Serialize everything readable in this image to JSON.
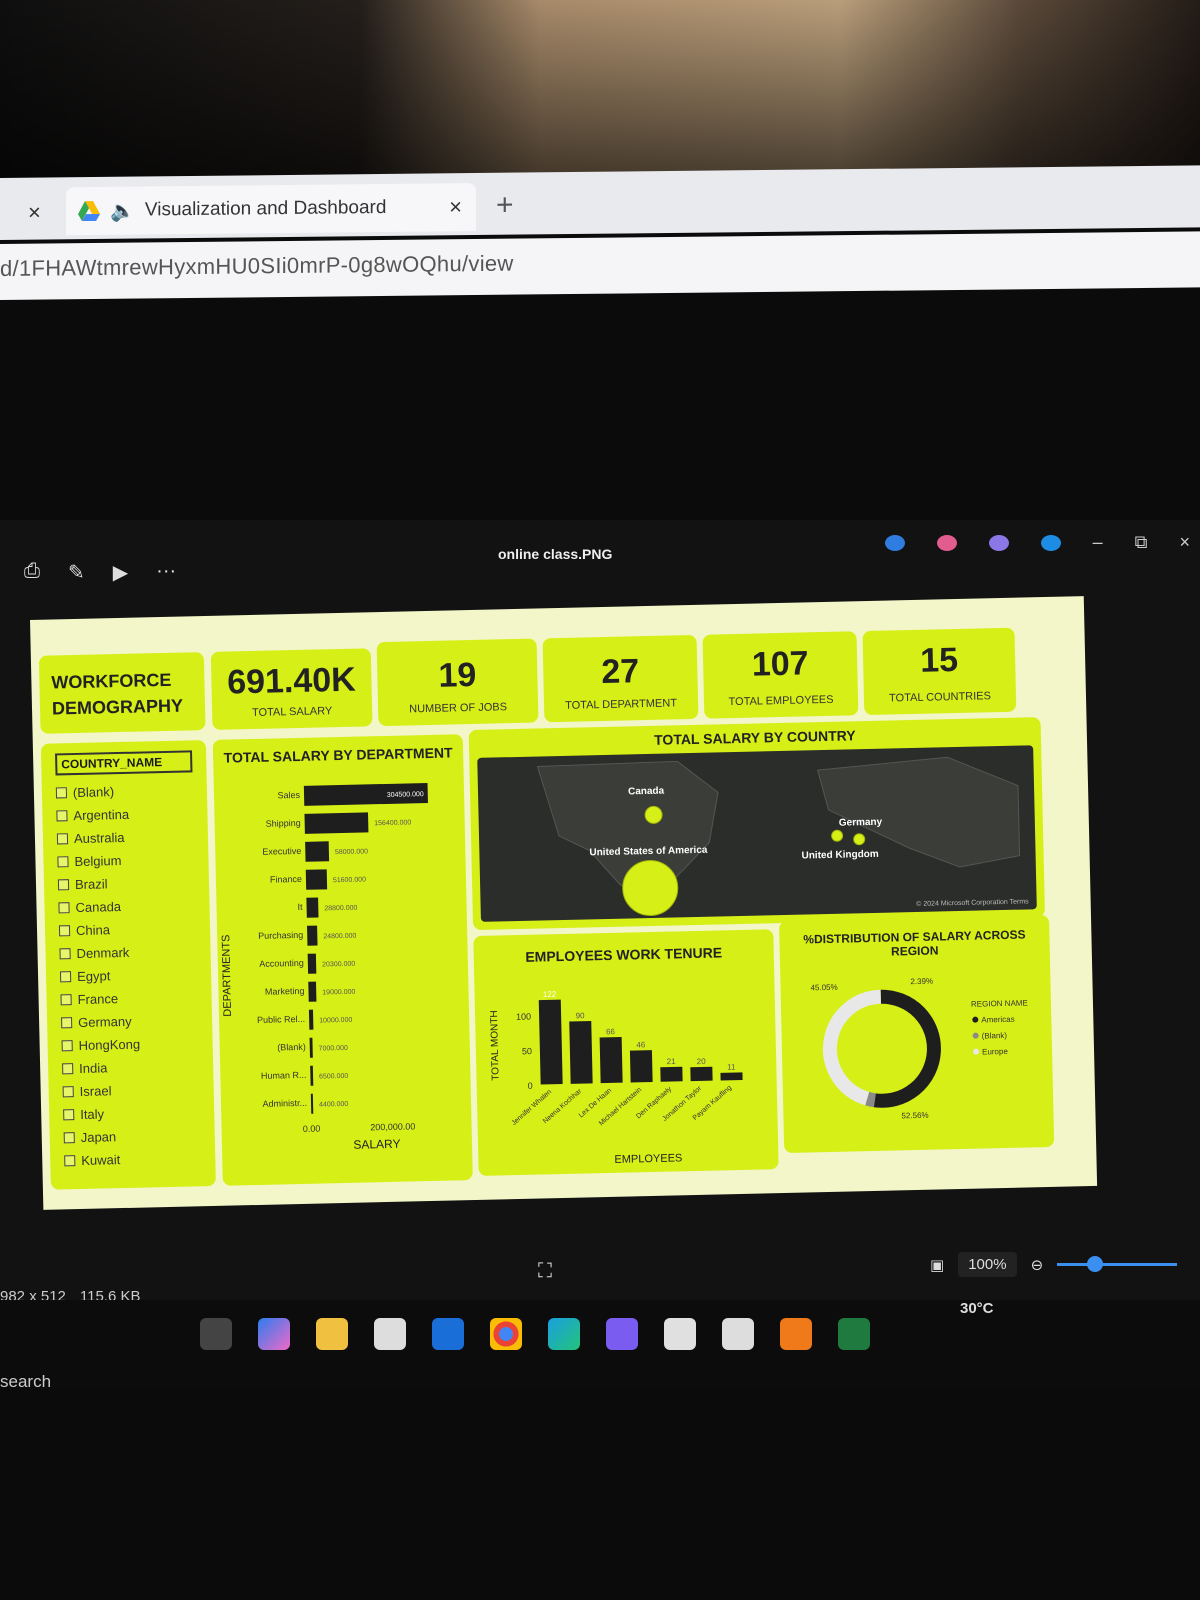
{
  "browser": {
    "tab_title": "Visualization and Dashboard",
    "url": "d/1FHAWtmrewHyxmHU0SIi0mrP-0g8wOQhu/view",
    "new_tab": "+",
    "close": "×"
  },
  "viewer": {
    "title": "online class.PNG",
    "tools": [
      "⎙",
      "✎",
      "▶",
      "···"
    ],
    "window_controls": [
      "–",
      "⧉",
      "×"
    ],
    "dims": "982 x 512",
    "size": "115.6 KB",
    "zoom": "100%",
    "search": "search",
    "weather": "30°C"
  },
  "dashboard": {
    "title": "WORKFORCE DEMOGRAPHY",
    "kpis": [
      {
        "value": "691.40K",
        "label": "TOTAL SALARY"
      },
      {
        "value": "19",
        "label": "NUMBER OF JOBS"
      },
      {
        "value": "27",
        "label": "TOTAL DEPARTMENT"
      },
      {
        "value": "107",
        "label": "TOTAL EMPLOYEES"
      },
      {
        "value": "15",
        "label": "TOTAL COUNTRIES"
      }
    ],
    "slicer": {
      "header": "COUNTRY_NAME",
      "items": [
        "(Blank)",
        "Argentina",
        "Australia",
        "Belgium",
        "Brazil",
        "Canada",
        "China",
        "Denmark",
        "Egypt",
        "France",
        "Germany",
        "HongKong",
        "India",
        "Israel",
        "Italy",
        "Japan",
        "Kuwait"
      ]
    },
    "map": {
      "title": "TOTAL SALARY BY COUNTRY",
      "labels": [
        "Canada",
        "United States of America",
        "Germany",
        "United Kingdom"
      ],
      "footer": "© 2024 Microsoft Corporation Terms"
    },
    "pie": {
      "title": "%DISTRIBUTION OF SALARY ACROSS REGION",
      "legend_title": "REGION NAME",
      "legend": [
        "Americas",
        "(Blank)",
        "Europe"
      ],
      "labels": [
        "45.05%",
        "2.39%",
        "52.56%"
      ]
    },
    "colors": {
      "accent": "#d6ef16",
      "dark": "#1e1e1e"
    }
  },
  "chart_data": [
    {
      "type": "bar",
      "title": "TOTAL SALARY BY DEPARTMENT",
      "orientation": "horizontal",
      "categories": [
        "Sales",
        "Shipping",
        "Executive",
        "Finance",
        "It",
        "Purchasing",
        "Accounting",
        "Marketing",
        "Public Rel...",
        "(Blank)",
        "Human R...",
        "Administr..."
      ],
      "values": [
        304500,
        156400,
        58000,
        51600,
        28800,
        24800,
        20300,
        19000,
        10000,
        7000,
        6500,
        4400
      ],
      "value_labels": [
        "304500.000",
        "156400.000",
        "58000.000",
        "51600.000",
        "28800.000",
        "24800.000",
        "20300.000",
        "19000.000",
        "10000.000",
        "7000.000",
        "6500.000",
        "4400.000"
      ],
      "xlabel": "SALARY",
      "ylabel": "DEPARTMENTS",
      "xticks": [
        "0.00",
        "200,000.00"
      ],
      "xlim": [
        0,
        320000
      ]
    },
    {
      "type": "bar",
      "title": "EMPLOYEES WORK TENURE",
      "categories": [
        "Jennifer Whalen",
        "Neena Kochhar",
        "Lex De Haan",
        "Michael Hartstein",
        "Den Raphaely",
        "Jonathon Taylor",
        "Payam Kaufling"
      ],
      "values": [
        122,
        90,
        66,
        46,
        21,
        20,
        11
      ],
      "xlabel": "EMPLOYEES",
      "ylabel": "TOTAL MONTH",
      "yticks": [
        "0",
        "50",
        "100"
      ],
      "ylim": [
        0,
        130
      ]
    },
    {
      "type": "pie",
      "title": "%DISTRIBUTION OF SALARY ACROSS REGION",
      "categories": [
        "Americas",
        "(Blank)",
        "Europe"
      ],
      "values": [
        52.56,
        2.39,
        45.05
      ]
    }
  ]
}
